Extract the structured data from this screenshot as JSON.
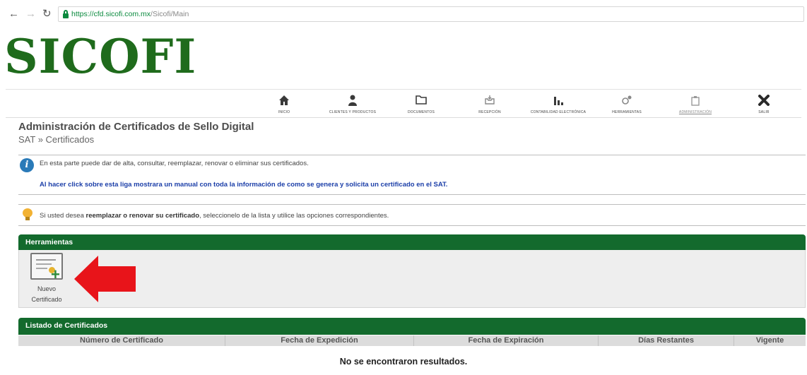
{
  "browser": {
    "back_icon": "arrow-left-icon",
    "forward_icon": "arrow-right-icon",
    "reload_icon": "reload-icon",
    "url_host": "https://cfd.sicofi.com.mx",
    "url_path": "/Sicofi/Main",
    "accent_color": "#0a8a3e"
  },
  "logo": {
    "text": "SICOFI",
    "color": "#1f6b1c"
  },
  "menu": [
    {
      "label": "INICIO",
      "icon": "home-icon"
    },
    {
      "label": "CLIENTES Y PRODUCTOS",
      "icon": "person-icon"
    },
    {
      "label": "DOCUMENTOS",
      "icon": "folder-icon"
    },
    {
      "label": "RECEPCIÓN",
      "icon": "inbox-icon"
    },
    {
      "label": "CONTABILIDAD ELECTRÓNICA",
      "icon": "bar-chart-icon"
    },
    {
      "label": "HERRAMIENTAS",
      "icon": "gears-icon"
    },
    {
      "label": "ADMINISTRACIÓN",
      "icon": "admin-icon",
      "active": true
    },
    {
      "label": "SALIR",
      "icon": "exit-icon"
    }
  ],
  "page": {
    "title": "Administración de Certificados de Sello Digital",
    "breadcrumb": "SAT » Certificados"
  },
  "info": {
    "icon": "info-icon",
    "text": "En esta parte puede dar de alta, consultar, reemplazar, renovar o eliminar sus certificados.",
    "link": "Al hacer click sobre esta liga mostrara un manual con toda la información de como se genera y solicita un certificado en el SAT."
  },
  "tip": {
    "icon": "lightbulb-icon",
    "before": "Si usted desea ",
    "bold": "reemplazar o renovar su certificado",
    "after": ", seleccionelo de la lista y utilice las opciones correspondientes."
  },
  "tools": {
    "header": "Herramientas",
    "new_cert_line1": "Nuevo",
    "new_cert_line2": "Certificado",
    "new_cert_icon": "new-certificate-icon",
    "arrow_color": "#e8141a"
  },
  "list": {
    "header": "Listado de Certificados",
    "columns": [
      "Número de Certificado",
      "Fecha de Expedición",
      "Fecha de Expiración",
      "Días Restantes",
      "Vigente"
    ],
    "empty_message": "No se encontraron resultados."
  },
  "colors": {
    "panel_green": "#136a2d",
    "link_blue": "#1b3ea8"
  }
}
